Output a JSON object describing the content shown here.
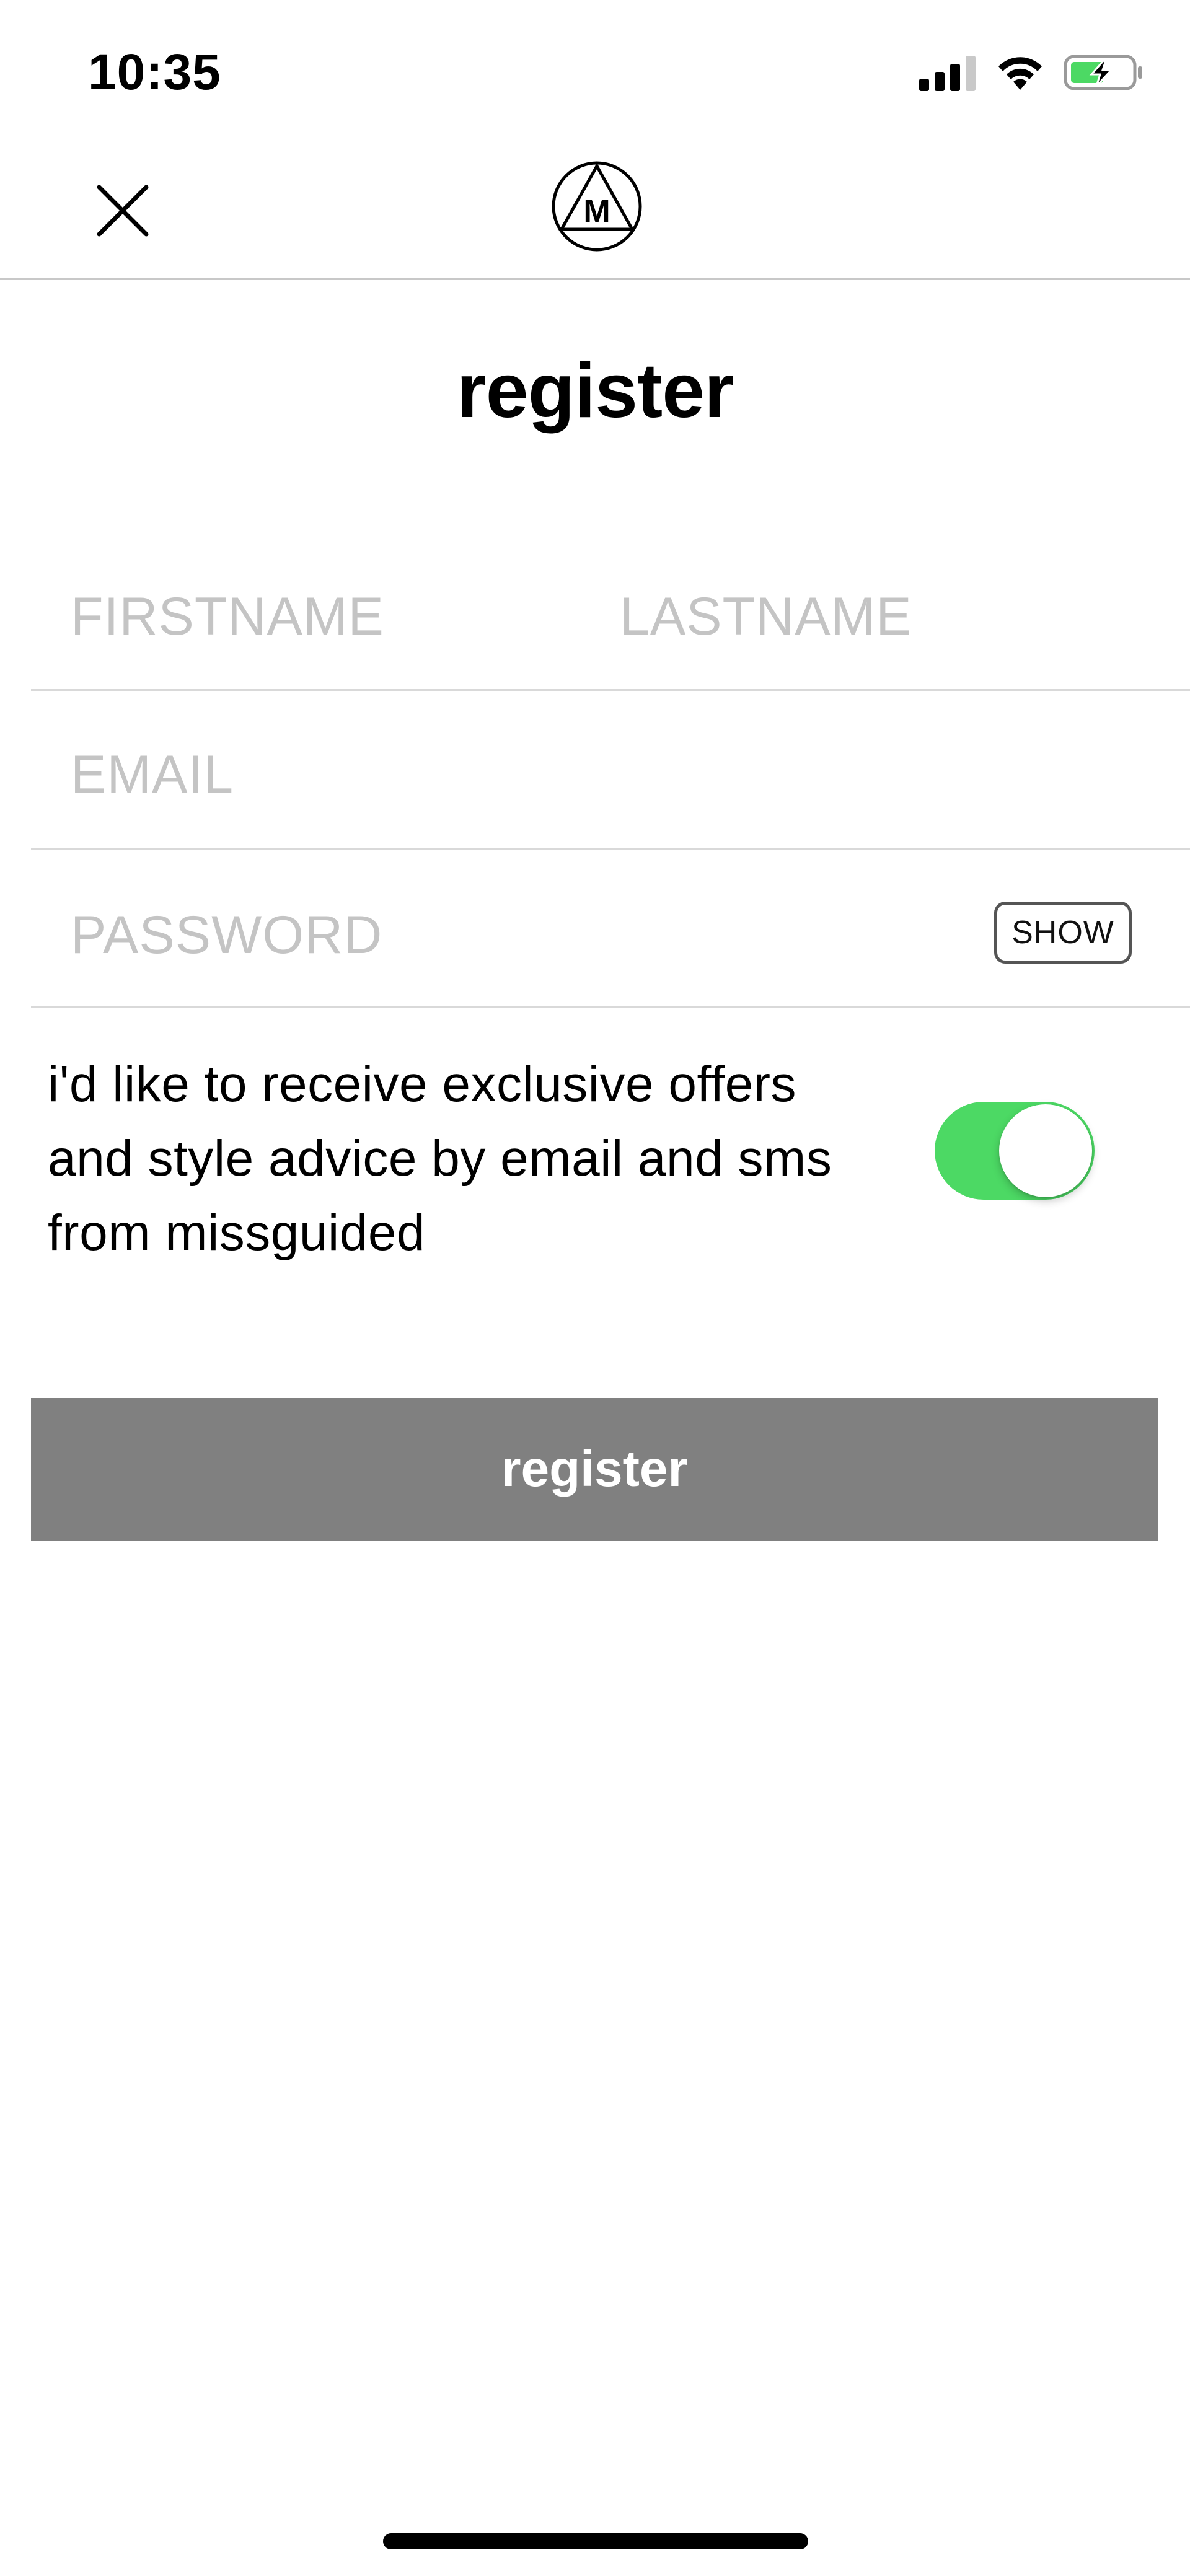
{
  "status_bar": {
    "time": "10:35"
  },
  "header": {
    "logo_letter": "M"
  },
  "page": {
    "title": "register"
  },
  "form": {
    "firstname": {
      "value": "",
      "placeholder": "FIRSTNAME"
    },
    "lastname": {
      "value": "",
      "placeholder": "LASTNAME"
    },
    "email": {
      "value": "",
      "placeholder": "EMAIL"
    },
    "password": {
      "value": "",
      "placeholder": "PASSWORD",
      "show_label": "SHOW"
    },
    "consent": {
      "lines": [
        "i'd like to receive exclusive offers",
        "and style advice by email and sms",
        "from missguided"
      ],
      "toggle_on": true
    },
    "submit_label": "register"
  },
  "colors": {
    "toggle_on": "#4cd964",
    "button_bg": "#808080",
    "placeholder": "#c4c4c4",
    "battery_charging": "#4cd964"
  }
}
